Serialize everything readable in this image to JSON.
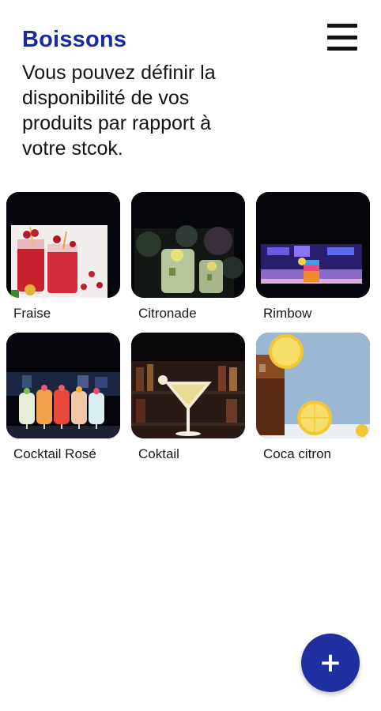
{
  "header": {
    "title": "Boissons",
    "subtitle": "Vous pouvez définir la disponibilité de vos produits par rapport à votre stcok.",
    "menu_icon": "hamburger-menu-icon"
  },
  "products": [
    {
      "name": "Fraise",
      "image": "strawberry-drink-photo"
    },
    {
      "name": "Citronade",
      "image": "lemonade-drink-photo"
    },
    {
      "name": "Rimbow",
      "image": "rainbow-cocktail-photo"
    },
    {
      "name": "Cocktail Rosé",
      "image": "cocktail-glasses-photo"
    },
    {
      "name": "Coktail",
      "image": "martini-glass-photo"
    },
    {
      "name": "Coca citron",
      "image": "coca-lemon-photo"
    }
  ],
  "fab": {
    "label": "+",
    "icon": "plus-icon"
  },
  "colors": {
    "accent": "#1f2fa0",
    "title": "#1a2a9c",
    "text": "#141414",
    "background": "#ffffff"
  }
}
